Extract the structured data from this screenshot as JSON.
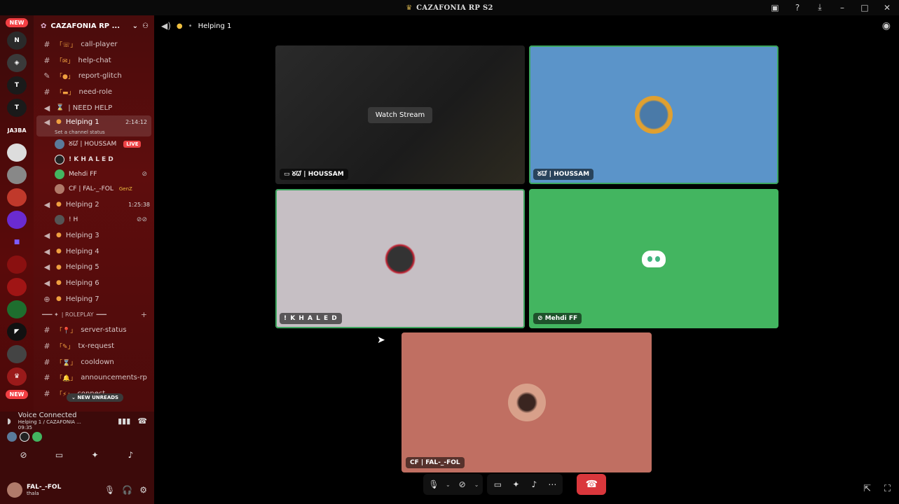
{
  "window": {
    "title": "CAZAFONIA RP S2",
    "controls": [
      "inbox-icon",
      "help-icon",
      "download-icon",
      "minimize-icon",
      "maximize-icon",
      "close-icon"
    ]
  },
  "rail": {
    "new_top": "NEW",
    "new_bottom": "NEW",
    "server_badges": [
      "JA3BA"
    ]
  },
  "sidebar": {
    "server_name": "CAZAFONIA RP ...",
    "channels": [
      {
        "type": "text",
        "name": "call-player"
      },
      {
        "type": "text",
        "name": "help-chat"
      },
      {
        "type": "forum",
        "name": "report-glitch"
      },
      {
        "type": "text",
        "name": "need-role"
      },
      {
        "type": "voice",
        "name": "| NEED HELP"
      }
    ],
    "active_channel": {
      "name": "Helping 1",
      "time": "2:14:12",
      "status": "Set a channel status"
    },
    "helping1_members": [
      {
        "name": "ᘜᘺ | HOUSSAM",
        "live": "LIVE"
      },
      {
        "name": "! K H A L E D"
      },
      {
        "name": "Mehdi FF"
      },
      {
        "name": "CF | FAL-_-FOL",
        "tag": "GenZ"
      }
    ],
    "helping2": {
      "name": "Helping 2",
      "time": "1:25:38",
      "member": "! H"
    },
    "more_voice": [
      "Helping 3",
      "Helping 4",
      "Helping 5",
      "Helping 6",
      "Helping 7"
    ],
    "category": "| ROLEPLAY",
    "rp_channels": [
      "server-status",
      "tx-request",
      "cooldown",
      "announcements-rp",
      "connect"
    ],
    "new_unreads": "NEW UNREADS"
  },
  "voice_panel": {
    "title": "Voice Connected",
    "location": "Helping 1 / CAZAFONIA ...",
    "elapsed": "09:35"
  },
  "user": {
    "name": "FAL-_-FOL",
    "status": "thala"
  },
  "topbar": {
    "channel": "Helping 1"
  },
  "tiles": {
    "stream": {
      "name": "ᘜᘺ | HOUSSAM",
      "watch_label": "Watch Stream"
    },
    "houssam": {
      "name": "ᘜᘺ | HOUSSAM"
    },
    "khaled": {
      "name": "! K H A L E D"
    },
    "mehdi": {
      "name": "Mehdi FF"
    },
    "fal": {
      "name": "CF | FAL-_-FOL"
    }
  },
  "colors": {
    "speaking": "#3ba55d",
    "tile_blue": "#5b94c9",
    "tile_gray": "#c6bfc4",
    "tile_green": "#43b560",
    "tile_salmon": "#c06f62",
    "hangup": "#da373c"
  }
}
